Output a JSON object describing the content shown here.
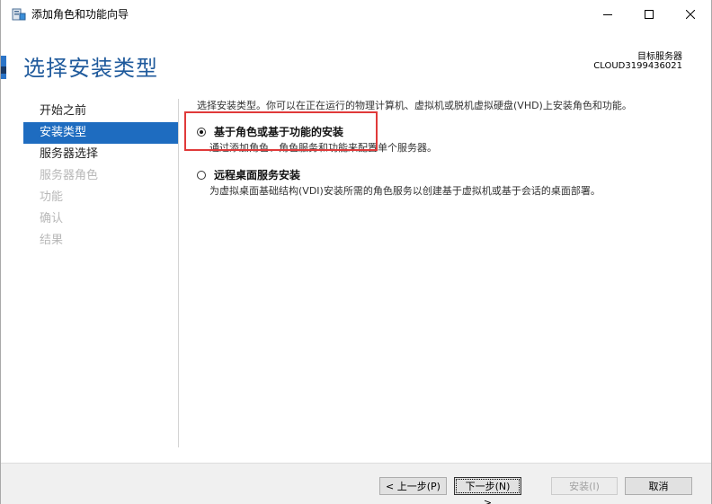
{
  "window": {
    "title": "添加角色和功能向导"
  },
  "header": {
    "page_title": "选择安装类型",
    "target_label": "目标服务器",
    "target_value": "CLOUD3199436021"
  },
  "nav": {
    "items": [
      {
        "label": "开始之前",
        "state": "normal"
      },
      {
        "label": "安装类型",
        "state": "active"
      },
      {
        "label": "服务器选择",
        "state": "normal"
      },
      {
        "label": "服务器角色",
        "state": "disabled"
      },
      {
        "label": "功能",
        "state": "disabled"
      },
      {
        "label": "确认",
        "state": "disabled"
      },
      {
        "label": "结果",
        "state": "disabled"
      }
    ]
  },
  "content": {
    "intro": "选择安装类型。你可以在正在运行的物理计算机、虚拟机或脱机虚拟硬盘(VHD)上安装角色和功能。",
    "options": [
      {
        "label": "基于角色或基于功能的安装",
        "description": "通过添加角色、角色服务和功能来配置单个服务器。",
        "checked": true
      },
      {
        "label": "远程桌面服务安装",
        "description": "为虚拟桌面基础结构(VDI)安装所需的角色服务以创建基于虚拟机或基于会话的桌面部署。",
        "checked": false
      }
    ]
  },
  "footer": {
    "prev_label": "< 上一步(P)",
    "next_label": "下一步(N) >",
    "install_label": "安装(I)",
    "cancel_label": "取消"
  },
  "colors": {
    "accent": "#1e6cc0",
    "title_blue": "#1f5a9c",
    "highlight_red": "#e03a3a"
  }
}
